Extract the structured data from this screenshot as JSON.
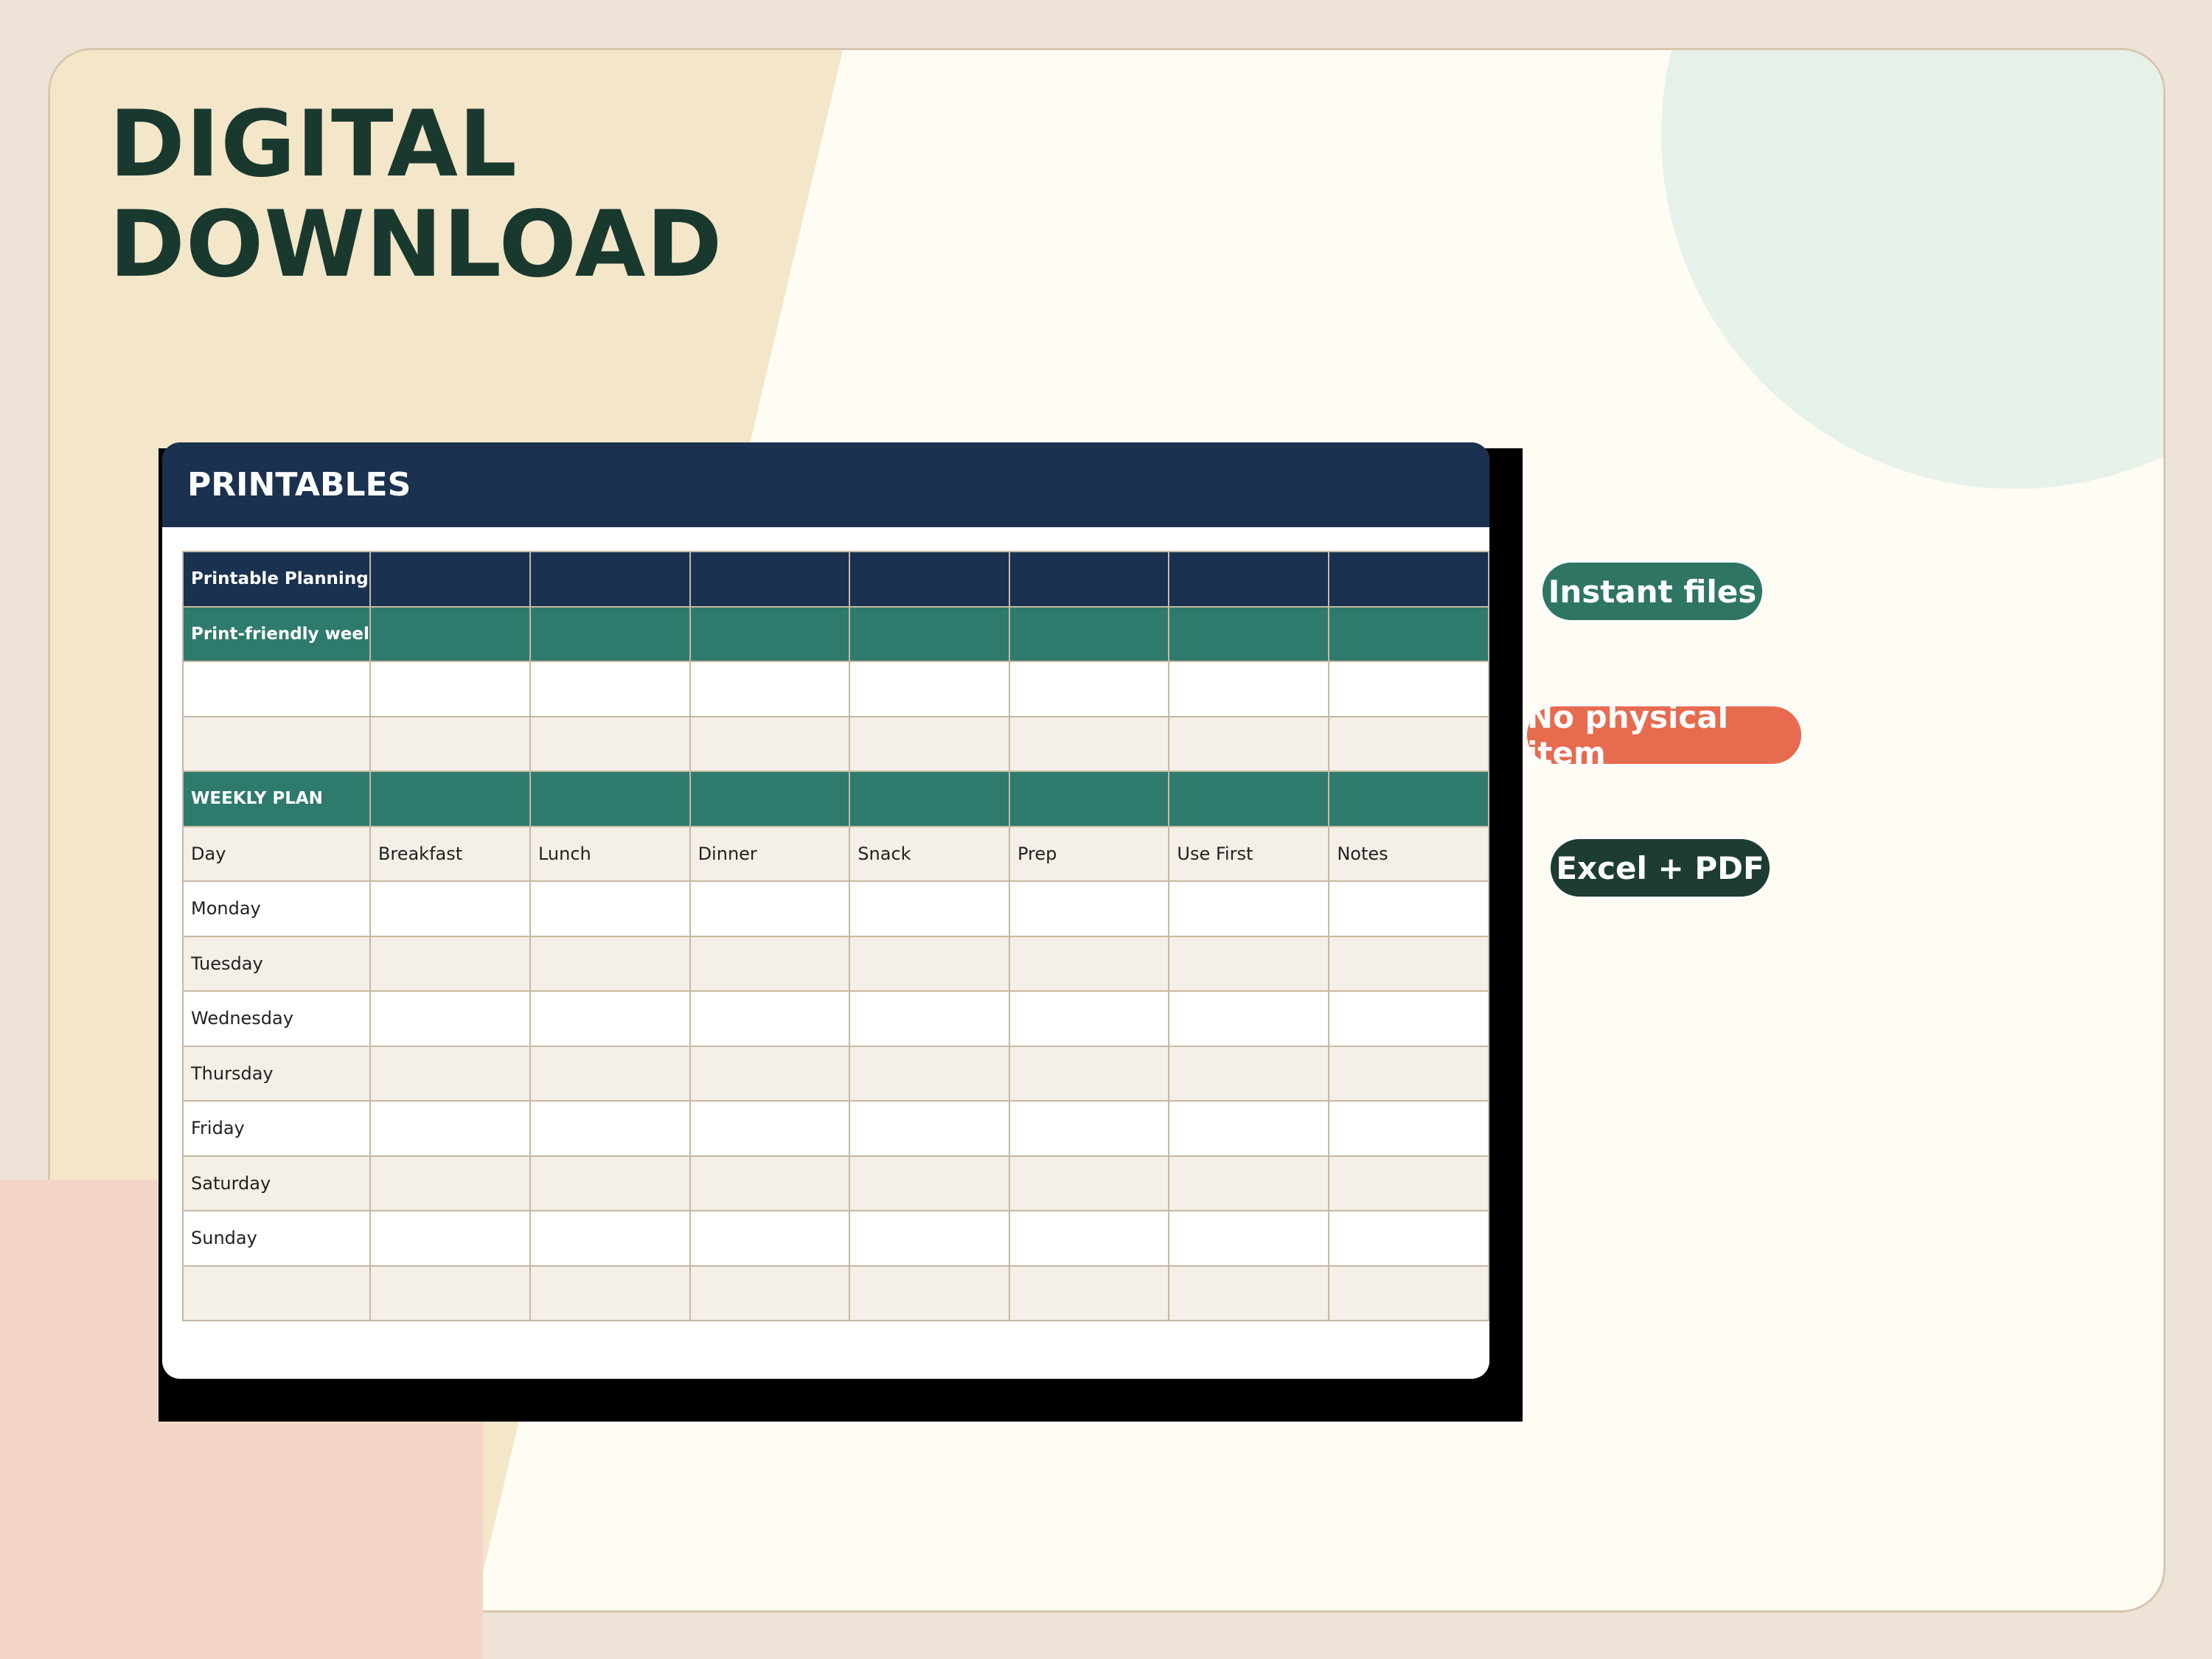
{
  "headline": {
    "line1": "DIGITAL",
    "line2": "DOWNLOAD"
  },
  "sheet": {
    "title": "PRINTABLES",
    "rows": [
      {
        "style": "navy",
        "cells": [
          "Printable Planning",
          "",
          "",
          "",
          "",
          "",
          "",
          ""
        ]
      },
      {
        "style": "teal",
        "cells": [
          "Print-friendly weel",
          "",
          "",
          "",
          "",
          "",
          "",
          ""
        ]
      },
      {
        "style": "white",
        "cells": [
          "",
          "",
          "",
          "",
          "",
          "",
          "",
          ""
        ]
      },
      {
        "style": "cream",
        "cells": [
          "",
          "",
          "",
          "",
          "",
          "",
          "",
          ""
        ]
      },
      {
        "style": "teal",
        "cells": [
          "WEEKLY PLAN",
          "",
          "",
          "",
          "",
          "",
          "",
          ""
        ]
      },
      {
        "style": "cream",
        "cells": [
          "Day",
          "Breakfast",
          "Lunch",
          "Dinner",
          "Snack",
          "Prep",
          "Use First",
          "Notes"
        ]
      },
      {
        "style": "white",
        "cells": [
          "Monday",
          "",
          "",
          "",
          "",
          "",
          "",
          ""
        ]
      },
      {
        "style": "cream",
        "cells": [
          "Tuesday",
          "",
          "",
          "",
          "",
          "",
          "",
          ""
        ]
      },
      {
        "style": "white",
        "cells": [
          "Wednesday",
          "",
          "",
          "",
          "",
          "",
          "",
          ""
        ]
      },
      {
        "style": "cream",
        "cells": [
          "Thursday",
          "",
          "",
          "",
          "",
          "",
          "",
          ""
        ]
      },
      {
        "style": "white",
        "cells": [
          "Friday",
          "",
          "",
          "",
          "",
          "",
          "",
          ""
        ]
      },
      {
        "style": "cream",
        "cells": [
          "Saturday",
          "",
          "",
          "",
          "",
          "",
          "",
          ""
        ]
      },
      {
        "style": "white",
        "cells": [
          "Sunday",
          "",
          "",
          "",
          "",
          "",
          "",
          ""
        ]
      },
      {
        "style": "cream",
        "cells": [
          "",
          "",
          "",
          "",
          "",
          "",
          "",
          ""
        ]
      }
    ]
  },
  "badges": {
    "instant": "Instant files",
    "no_physical": "No physical item",
    "formats": "Excel + PDF"
  },
  "colors": {
    "navy": "#1a3150",
    "teal": "#2e7a6d",
    "coral": "#e76b4f",
    "dark_green": "#1d3c32",
    "headline": "#19392f"
  }
}
